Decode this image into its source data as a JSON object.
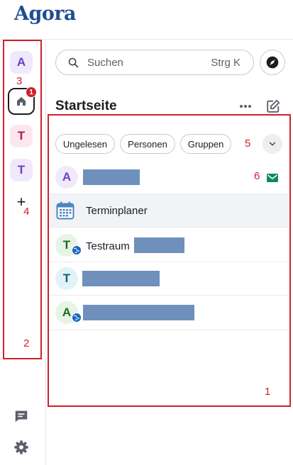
{
  "app": {
    "name": "Agora"
  },
  "spaces": [
    {
      "letter": "A",
      "color": "#6d3fc0",
      "bg": "#efe9fb"
    },
    {
      "letter": "T",
      "color": "#c4124f",
      "bg": "#fde7ee"
    },
    {
      "letter": "T",
      "color": "#6d3fc0",
      "bg": "#efe9fb"
    }
  ],
  "home": {
    "unread_badge": "1"
  },
  "add_space": {
    "label": "+"
  },
  "search": {
    "placeholder": "Suchen",
    "shortcut": "Strg K"
  },
  "home_panel": {
    "title": "Startseite"
  },
  "filters": [
    "Ungelesen",
    "Personen",
    "Gruppen"
  ],
  "rooms": [
    {
      "avatar_letter": "A",
      "avatar_color": "#6d3fc0",
      "avatar_bg": "#efe9fb",
      "name": "",
      "redacted": true,
      "icon": "envelope-icon",
      "globe": false
    },
    {
      "avatar_letter": "",
      "name": "Terminplaner",
      "icon": "calendar-icon",
      "globe": false,
      "highlighted": true
    },
    {
      "avatar_letter": "T",
      "avatar_color": "#1f6b2a",
      "avatar_bg": "#e5f4e3",
      "name": "Testraum",
      "redacted": true,
      "globe": true
    },
    {
      "avatar_letter": "T",
      "avatar_color": "#155e75",
      "avatar_bg": "#e1f3f8",
      "name": "",
      "redacted": true,
      "globe": false
    },
    {
      "avatar_letter": "A",
      "avatar_color": "#1f6b2a",
      "avatar_bg": "#e5f4e3",
      "name": "",
      "redacted": true,
      "globe": true
    }
  ],
  "annotations": [
    "1",
    "2",
    "3",
    "4",
    "5",
    "6"
  ],
  "colors": {
    "brand": "#1f4d8f",
    "annotation": "#d0202a",
    "redaction": "#6f90bd",
    "unread_dot": "#0f8a5f"
  }
}
